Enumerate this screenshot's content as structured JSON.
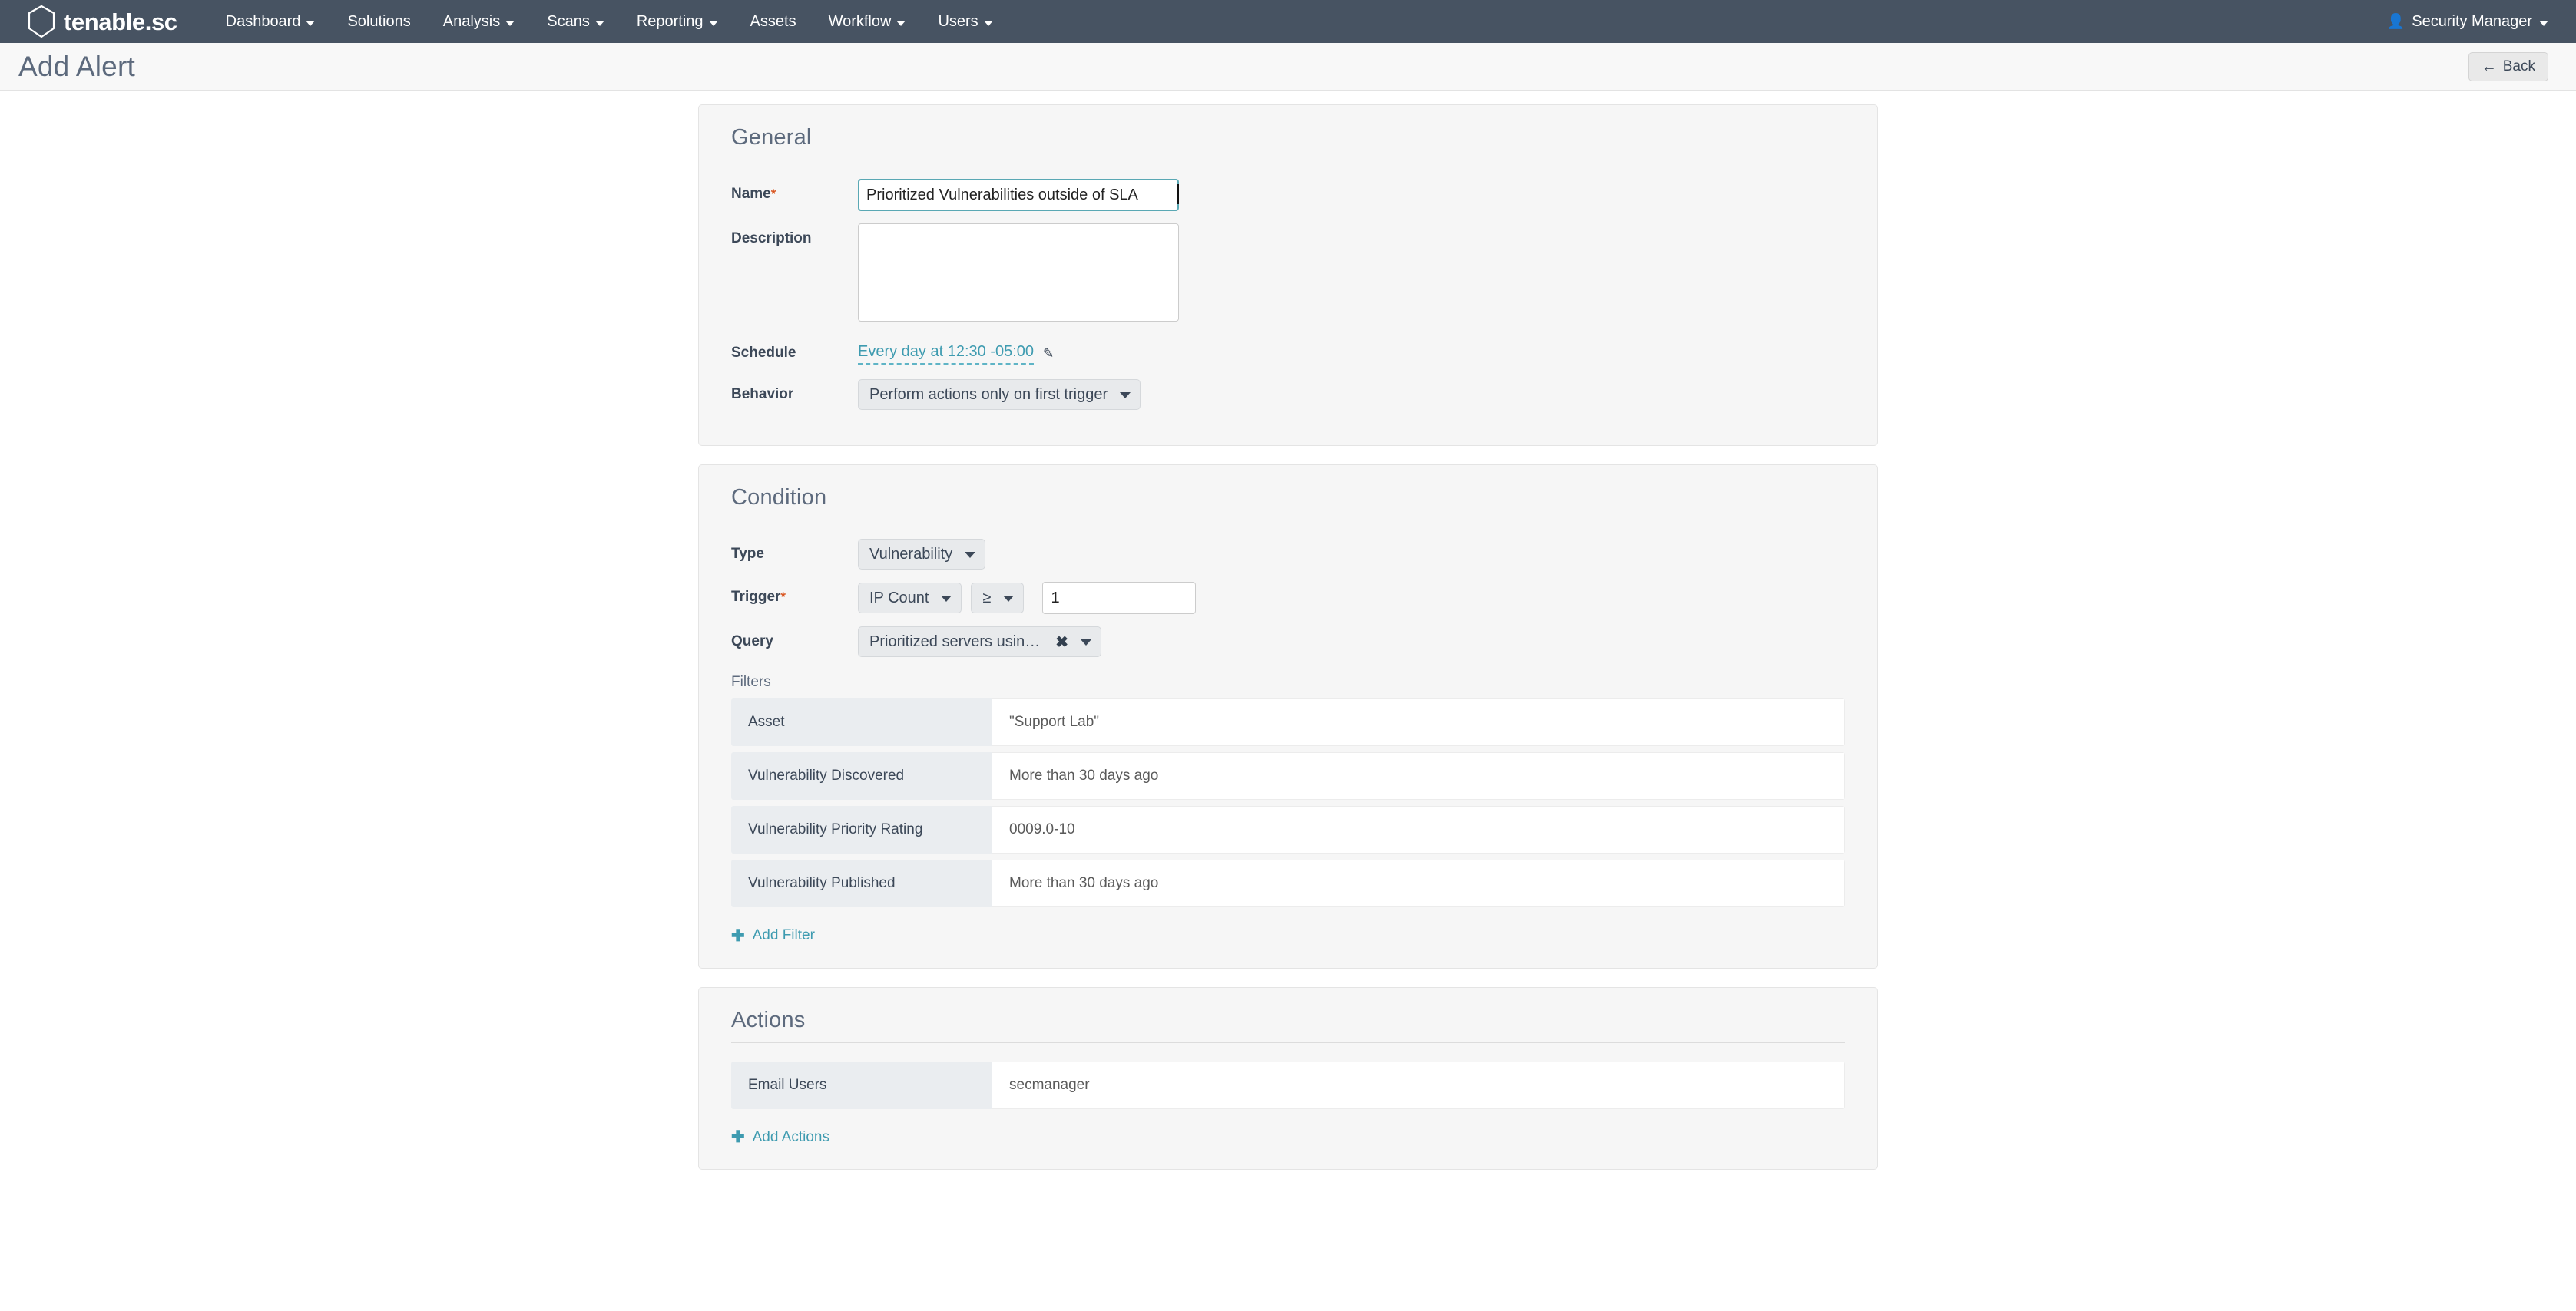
{
  "navbar": {
    "brand": "tenable.sc",
    "brand_tm": "˚",
    "items": [
      {
        "label": "Dashboard",
        "has_caret": true
      },
      {
        "label": "Solutions",
        "has_caret": false
      },
      {
        "label": "Analysis",
        "has_caret": true
      },
      {
        "label": "Scans",
        "has_caret": true
      },
      {
        "label": "Reporting",
        "has_caret": true
      },
      {
        "label": "Assets",
        "has_caret": false
      },
      {
        "label": "Workflow",
        "has_caret": true
      },
      {
        "label": "Users",
        "has_caret": true
      }
    ],
    "user": "Security Manager",
    "user_icon": "user-icon"
  },
  "header": {
    "title": "Add Alert",
    "back_label": "Back",
    "back_icon": "arrow-left-icon"
  },
  "general": {
    "title": "General",
    "name_label": "Name",
    "name_required": "*",
    "name_value": "Prioritized Vulnerabilities outside of SLA",
    "name_placeholder": "",
    "description_label": "Description",
    "description_value": "",
    "description_placeholder": "",
    "schedule_label": "Schedule",
    "schedule_value": "Every day at 12:30 -05:00",
    "schedule_edit_icon": "pencil-icon",
    "behavior_label": "Behavior",
    "behavior_value": "Perform actions only on first trigger"
  },
  "condition": {
    "title": "Condition",
    "type_label": "Type",
    "type_value": "Vulnerability",
    "trigger_label": "Trigger",
    "trigger_required": "*",
    "trigger_field": "IP Count",
    "trigger_operator": "≥",
    "trigger_value": "1",
    "query_label": "Query",
    "query_value": "Prioritized servers usin…",
    "query_clear_icon": "close-icon",
    "filters_label": "Filters",
    "filters": [
      {
        "key": "Asset",
        "value": "\"Support Lab\""
      },
      {
        "key": "Vulnerability Discovered",
        "value": "More than 30 days ago"
      },
      {
        "key": "Vulnerability Priority Rating",
        "value": "0009.0-10"
      },
      {
        "key": "Vulnerability Published",
        "value": "More than 30 days ago"
      }
    ],
    "add_filter_label": "Add Filter",
    "add_filter_icon": "plus-icon"
  },
  "actions": {
    "title": "Actions",
    "rows": [
      {
        "key": "Email Users",
        "value": "secmanager"
      }
    ],
    "add_actions_label": "Add Actions",
    "add_actions_icon": "plus-icon"
  },
  "colors": {
    "navbar_bg": "#475362",
    "accent_teal": "#3e9bb0",
    "focus_teal": "#5aa8b4",
    "required_orange": "#d9541e",
    "heading_slate": "#5d6a7d",
    "card_bg": "#f6f6f6"
  }
}
